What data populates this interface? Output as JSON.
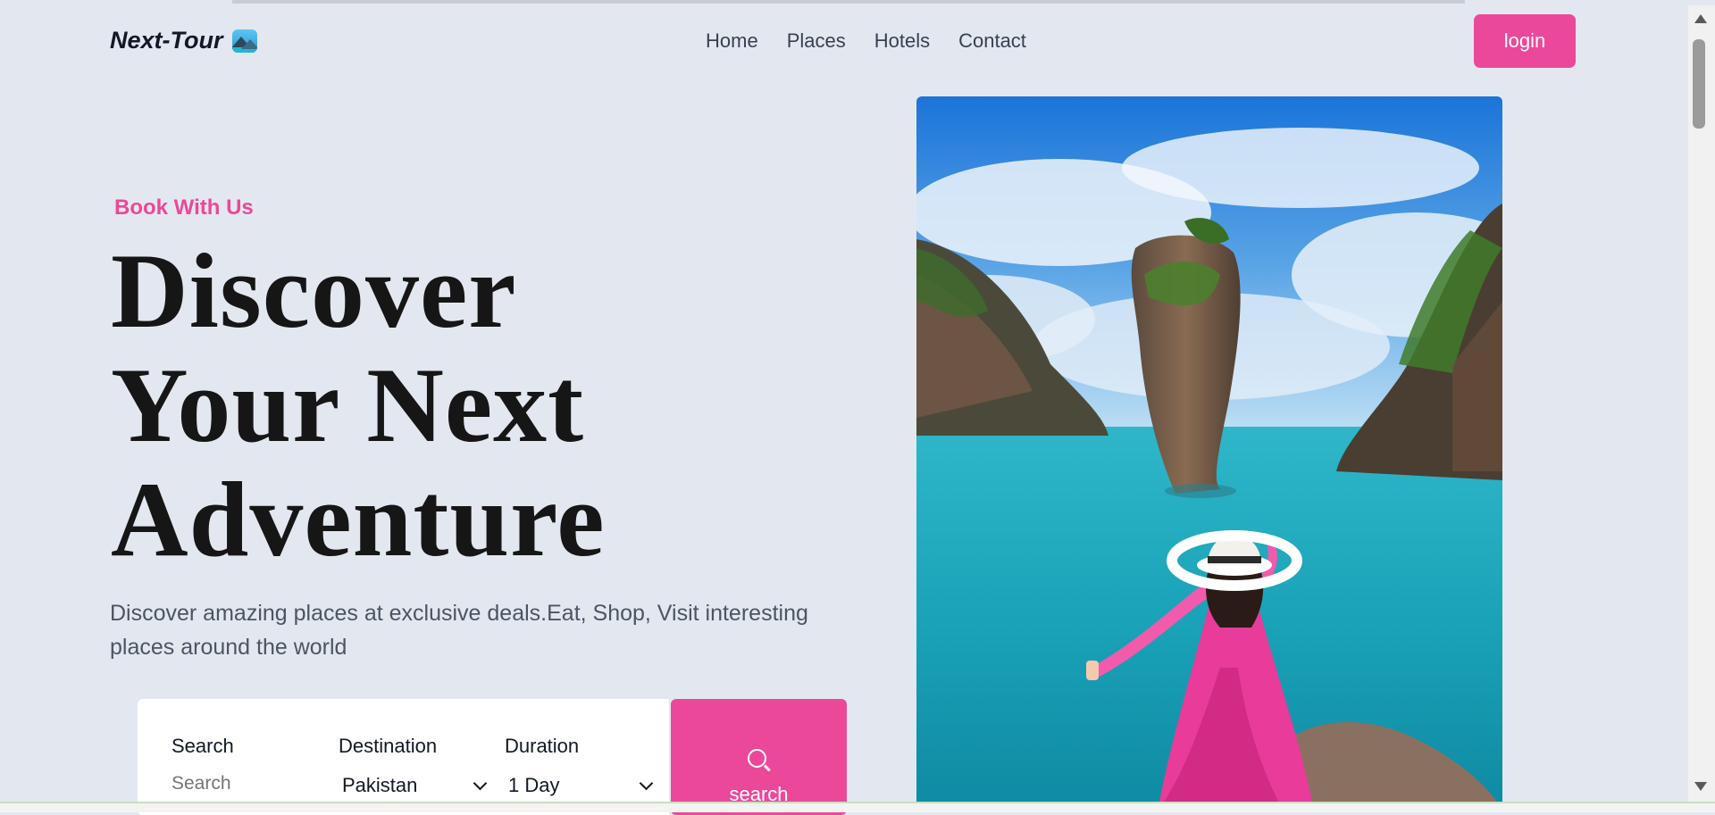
{
  "brand": {
    "name": "Next-Tour",
    "icon": "landscape-logo-icon"
  },
  "nav": {
    "items": [
      "Home",
      "Places",
      "Hotels",
      "Contact"
    ]
  },
  "header": {
    "login_label": "login"
  },
  "hero": {
    "eyebrow": "Book With Us",
    "headline": [
      "Discover",
      "Your Next",
      "Adventure"
    ],
    "description": "Discover amazing places at exclusive deals.Eat, Shop, Visit interesting places around the world"
  },
  "search_form": {
    "search_label": "Search",
    "search_placeholder": "Search",
    "destination_label": "Destination",
    "destination_value": "Pakistan",
    "duration_label": "Duration",
    "duration_value": "1 Day",
    "button_label": "search"
  },
  "colors": {
    "accent": "#ec4899",
    "background": "#e3e8f0",
    "text": "#161616"
  }
}
